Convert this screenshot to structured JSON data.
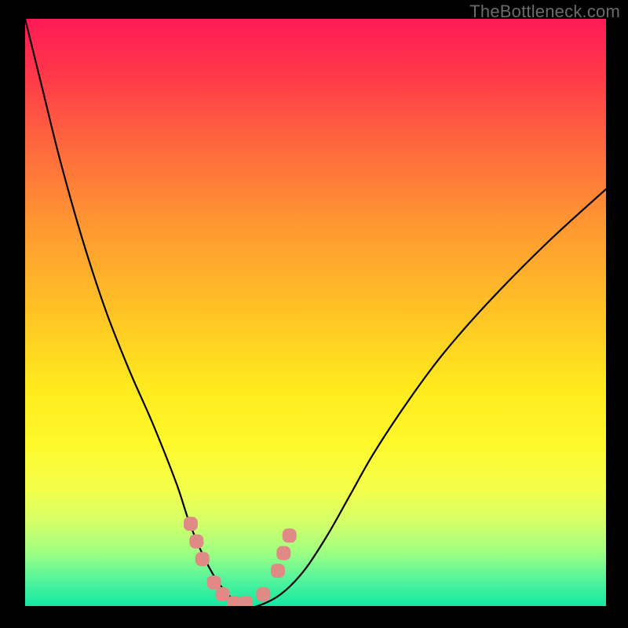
{
  "watermark": "TheBottleneck.com",
  "chart_data": {
    "type": "line",
    "title": "",
    "xlabel": "",
    "ylabel": "",
    "xlim": [
      0,
      100
    ],
    "ylim": [
      0,
      100
    ],
    "x": [
      0,
      3,
      6,
      10,
      14,
      18,
      22,
      26,
      28,
      30,
      32,
      34,
      36,
      38,
      40,
      44,
      48,
      52,
      56,
      60,
      66,
      72,
      80,
      90,
      100
    ],
    "values": [
      100,
      88,
      76,
      62,
      50,
      40,
      31,
      21,
      15,
      10,
      6,
      3,
      1,
      0,
      0,
      2,
      6,
      12,
      19,
      26,
      35,
      43,
      52,
      62,
      71
    ],
    "markers": {
      "x": [
        28.5,
        29.5,
        30.5,
        32.5,
        34,
        36,
        38,
        41,
        43.5,
        44.5,
        45.5
      ],
      "values": [
        14,
        11,
        8,
        4,
        2,
        0.5,
        0.5,
        2,
        6,
        9,
        12
      ]
    },
    "colors": {
      "curve": "#000000",
      "marker": "#e08a86",
      "background_top": "#ff1a56",
      "background_bottom": "#13e8a3"
    }
  }
}
